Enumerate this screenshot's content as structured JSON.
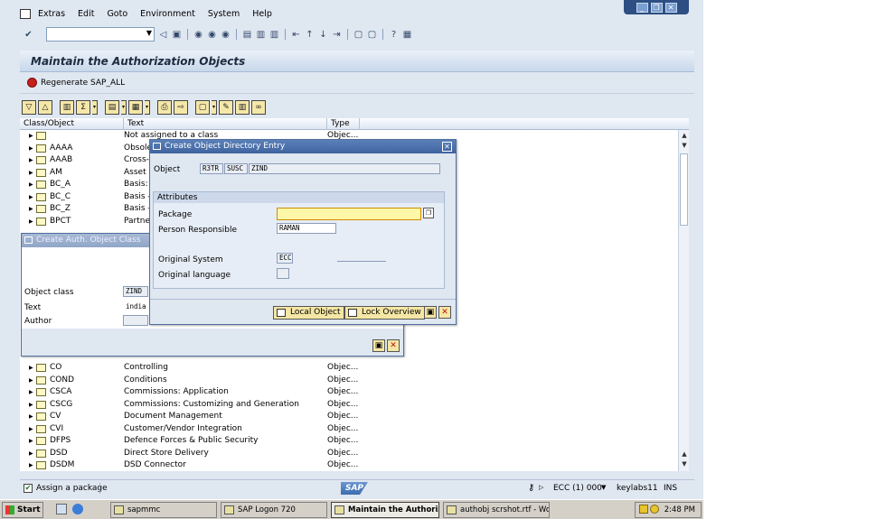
{
  "menubar": {
    "items": [
      "Extras",
      "Edit",
      "Goto",
      "Environment",
      "System",
      "Help"
    ]
  },
  "window": {
    "title": "Maintain the Authorization Objects"
  },
  "app_toolbar": {
    "regenerate_label": "Regenerate SAP_ALL"
  },
  "list": {
    "columns": [
      "Class/Object",
      "Text",
      "Type"
    ],
    "rows_top": [
      {
        "obj": "",
        "text": "Not assigned to a class",
        "type": "Objec..."
      },
      {
        "obj": "AAAA",
        "text": "Obsole",
        "type": ""
      },
      {
        "obj": "AAAB",
        "text": "Cross-a",
        "type": ""
      },
      {
        "obj": "AM",
        "text": "Asset",
        "type": ""
      },
      {
        "obj": "BC_A",
        "text": "Basis: A",
        "type": ""
      },
      {
        "obj": "BC_C",
        "text": "Basis -",
        "type": ""
      },
      {
        "obj": "BC_Z",
        "text": "Basis -",
        "type": ""
      },
      {
        "obj": "BPCT",
        "text": "Partne",
        "type": ""
      }
    ],
    "rows_bottom": [
      {
        "obj": "CO",
        "text": "Controlling",
        "type": "Objec..."
      },
      {
        "obj": "COND",
        "text": "Conditions",
        "type": "Objec..."
      },
      {
        "obj": "CSCA",
        "text": "Commissions: Application",
        "type": "Objec..."
      },
      {
        "obj": "CSCG",
        "text": "Commissions: Customizing and Generation",
        "type": "Objec..."
      },
      {
        "obj": "CV",
        "text": "Document Management",
        "type": "Objec..."
      },
      {
        "obj": "CVI",
        "text": "Customer/Vendor Integration",
        "type": "Objec..."
      },
      {
        "obj": "DFPS",
        "text": "Defence Forces & Public Security",
        "type": "Objec..."
      },
      {
        "obj": "DSD",
        "text": "Direct Store Delivery",
        "type": "Objec..."
      },
      {
        "obj": "DSDM",
        "text": "DSD Connector",
        "type": "Objec..."
      }
    ]
  },
  "auth_dialog": {
    "title": "Create Auth. Object Class",
    "object_class_label": "Object class",
    "object_class_value": "ZIND",
    "text_label": "Text",
    "text_value": "india a",
    "author_label": "Author"
  },
  "dir_dialog": {
    "title": "Create Object Directory Entry",
    "object_label": "Object",
    "object_v1": "R3TR",
    "object_v2": "SUSC",
    "object_v3": "ZIND",
    "attributes_title": "Attributes",
    "package_label": "Package",
    "package_value": "",
    "person_label": "Person Responsible",
    "person_value": "RAMAN",
    "orig_system_label": "Original System",
    "orig_system_value": "ECC",
    "orig_lang_label": "Original language",
    "local_object_label": "Local Object",
    "lock_overview_label": "Lock Overview"
  },
  "status": {
    "assign_label": "Assign a package",
    "system_info": "ECC (1) 000",
    "server": "keylabs11",
    "mode": "INS",
    "logo_text": "SAP"
  },
  "taskbar": {
    "start": "Start",
    "tasks": [
      "sapmmc",
      "SAP Logon 720",
      "Maintain the Authoriz...",
      "authobj scrshot.rtf - Wo..."
    ],
    "clock": "2:48 PM"
  },
  "colors": {
    "title_blue": "#3f63a0",
    "button_yellow": "#f4e6a4",
    "package_required": "#fff7a8",
    "close_red": "#c0120c"
  }
}
